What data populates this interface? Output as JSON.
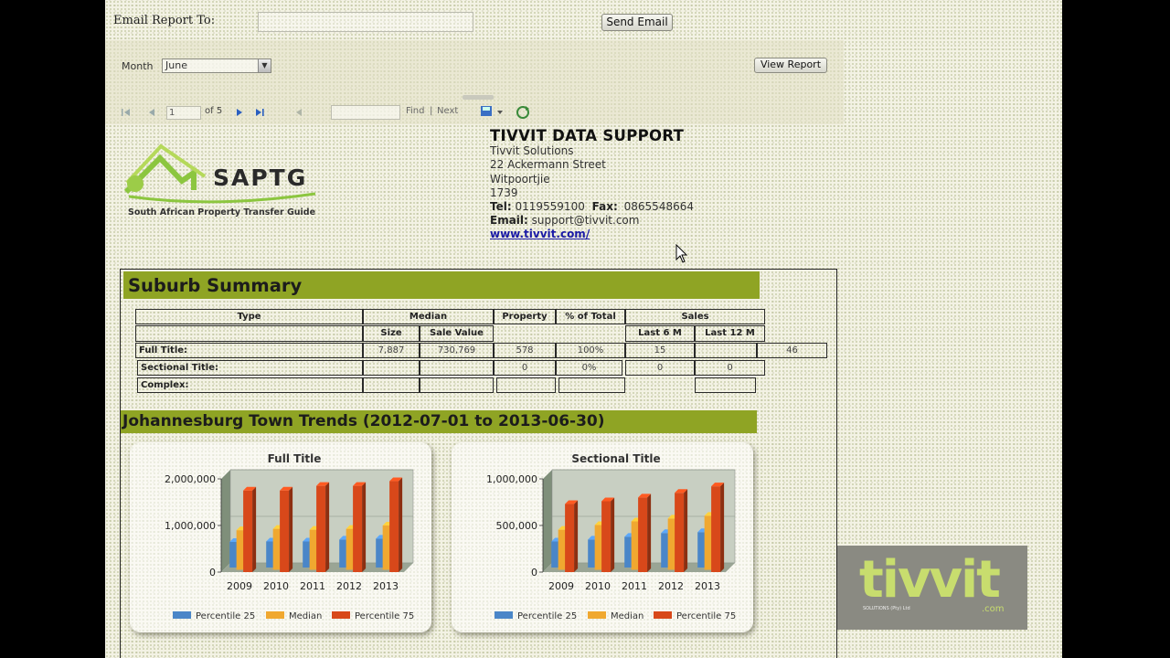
{
  "email_bar": {
    "label": "Email Report To:",
    "input_value": "",
    "send_button": "Send Email"
  },
  "params": {
    "month_label": "Month",
    "month_value": "June",
    "view_report_button": "View Report"
  },
  "toolbar": {
    "current_page": "1",
    "page_of": "of 5",
    "find_label": "Find",
    "separator": "|",
    "next_label": "Next",
    "icons": [
      "first-page-icon",
      "prev-page-icon",
      "next-page-icon",
      "last-page-icon",
      "back-icon",
      "export-icon",
      "refresh-icon"
    ]
  },
  "header": {
    "logo_text": "SAPTG",
    "logo_subtitle": "South African Property Transfer Guide",
    "company_title": "TIVVIT DATA SUPPORT",
    "company_name": "Tivvit Solutions",
    "street": "22 Ackermann Street",
    "suburb": "Witpoortjie",
    "postcode": "1739",
    "tel_label": "Tel:",
    "tel": "0119559100",
    "fax_label": "Fax:",
    "fax": "0865548664",
    "email_label": "Email:",
    "email": "support@tivvit.com",
    "website": "www.tivvit.com/"
  },
  "suburb_summary": {
    "title": "Suburb Summary",
    "headers": {
      "type": "Type",
      "median": "Median",
      "size": "Size",
      "sale_value": "Sale Value",
      "property": "Property",
      "pct_total": "% of Total",
      "sales": "Sales",
      "last6": "Last 6 M",
      "last12": "Last 12 M"
    },
    "rows": [
      {
        "type": "Full Title:",
        "size": "7,887",
        "sale_value": "730,769",
        "property": "578",
        "pct": "100%",
        "last6": "15",
        "last12": "",
        "extra": "46"
      },
      {
        "type": "Sectional Title:",
        "size": "",
        "sale_value": "",
        "property": "0",
        "pct": "0%",
        "last6": "0",
        "last12": "0",
        "extra": ""
      },
      {
        "type": "Complex:",
        "size": "",
        "sale_value": "",
        "property": "",
        "pct": "",
        "last6": "",
        "last12": "",
        "extra": ""
      }
    ]
  },
  "trends": {
    "title": "Johannesburg Town Trends (2012-07-01 to 2013-06-30)"
  },
  "chart_data": [
    {
      "type": "bar",
      "title": "Full Title",
      "categories": [
        "2009",
        "2010",
        "2011",
        "2012",
        "2013"
      ],
      "ylim": [
        0,
        2000000
      ],
      "yticks": [
        "2,000,000",
        "1,000,000",
        "0"
      ],
      "ytick_values": [
        2000000,
        1000000,
        0
      ],
      "series": [
        {
          "name": "Percentile 25",
          "values": [
            550000,
            560000,
            560000,
            600000,
            620000
          ],
          "color": "#4a86c8"
        },
        {
          "name": "Median",
          "values": [
            850000,
            880000,
            860000,
            880000,
            950000
          ],
          "color": "#f0a830"
        },
        {
          "name": "Percentile 75",
          "values": [
            1750000,
            1750000,
            1850000,
            1850000,
            1950000
          ],
          "color": "#d8481a"
        }
      ],
      "legend": "bottom"
    },
    {
      "type": "bar",
      "title": "Sectional Title",
      "categories": [
        "2009",
        "2010",
        "2011",
        "2012",
        "2013"
      ],
      "ylim": [
        0,
        1000000
      ],
      "yticks": [
        "1,000,000",
        "500,000",
        "0"
      ],
      "ytick_values": [
        1000000,
        500000,
        0
      ],
      "series": [
        {
          "name": "Percentile 25",
          "values": [
            280000,
            300000,
            330000,
            370000,
            380000
          ],
          "color": "#4a86c8"
        },
        {
          "name": "Median",
          "values": [
            430000,
            480000,
            520000,
            550000,
            580000
          ],
          "color": "#f0a830"
        },
        {
          "name": "Percentile 75",
          "values": [
            730000,
            760000,
            800000,
            850000,
            920000
          ],
          "color": "#d8481a"
        }
      ],
      "legend": "bottom"
    }
  ],
  "branding": {
    "corner_logo": "tivvit",
    "corner_logo_sub": "SOLUTIONS (Pty) Ltd",
    "corner_logo_com": ".com"
  },
  "colors": {
    "section_header": "#8fa424",
    "link": "#1a1aa6",
    "logo_green": "#8cc63f"
  }
}
